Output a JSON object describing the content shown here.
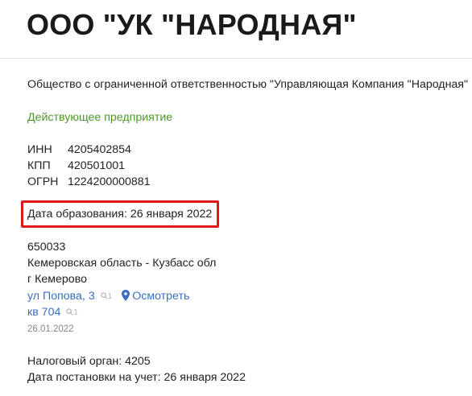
{
  "header": {
    "title": "ООО \"УК \"НАРОДНАЯ\""
  },
  "company": {
    "full_name": "Общество с ограниченной ответственностью \"Управляющая Компания \"Народная\"",
    "status": "Действующее предприятие",
    "status_color": "#4d9a2a"
  },
  "requisites": {
    "inn_label": "ИНН",
    "inn_value": "4205402854",
    "kpp_label": "КПП",
    "kpp_value": "420501001",
    "ogrn_label": "ОГРН",
    "ogrn_value": "1224200000881"
  },
  "registration": {
    "date_text": "Дата образования: 26 января 2022",
    "highlight_color": "#e01818"
  },
  "address": {
    "postcode": "650033",
    "region": "Кемеровская область - Кузбасс обл",
    "city": "г Кемерово",
    "street_link": "ул Попова, 3",
    "street_count": "1",
    "view_link": "Осмотреть",
    "flat_link": "кв 704",
    "flat_count": "1",
    "date": "26.01.2022",
    "link_color": "#3a6fc4"
  },
  "tax": {
    "office_text": "Налоговый орган: 4205",
    "registered_text": "Дата постановки на учет: 26 января 2022"
  }
}
